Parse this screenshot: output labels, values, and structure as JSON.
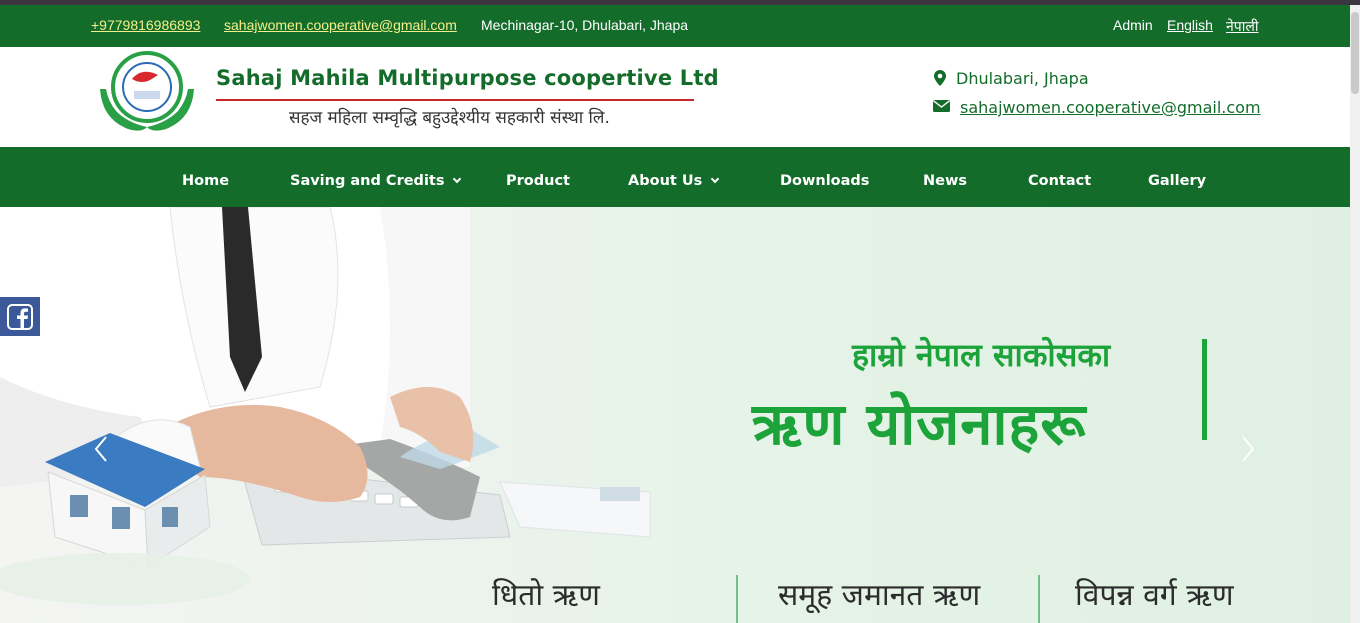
{
  "topbar": {
    "phone": "+9779816986893",
    "email": "sahajwomen.cooperative@gmail.com",
    "address": "Mechinagar-10, Dhulabari, Jhapa",
    "admin": "Admin",
    "lang_en": "English",
    "lang_np": "नेपाली"
  },
  "header": {
    "org_name": "Sahaj Mahila Multipurpose coopertive Ltd",
    "org_subtitle": "सहज महिला सम्वृद्धि बहुउद्देश्यीय सहकारी संस्था लि.",
    "location": "Dhulabari, Jhapa",
    "email": "sahajwomen.cooperative@gmail.com",
    "location_icon": "map-marker-icon",
    "email_icon": "envelope-icon"
  },
  "nav": {
    "items": [
      {
        "label": "Home",
        "has_dropdown": false
      },
      {
        "label": "Saving and Credits",
        "has_dropdown": true
      },
      {
        "label": "Product",
        "has_dropdown": false
      },
      {
        "label": "About Us",
        "has_dropdown": true
      },
      {
        "label": "Downloads",
        "has_dropdown": false
      },
      {
        "label": "News",
        "has_dropdown": false
      },
      {
        "label": "Contact",
        "has_dropdown": false
      },
      {
        "label": "Gallery",
        "has_dropdown": false
      }
    ]
  },
  "hero": {
    "line1": "हाम्रो नेपाल साकोसका",
    "line2": "ऋण योजनाहरू",
    "loans": [
      "धितो ऋण",
      "समूह जमानत ऋण",
      "विपन्न वर्ग ऋण"
    ]
  },
  "colors": {
    "primary_green": "#146c2b",
    "hero_green": "#1ca33a",
    "link_yellow": "#f3f08a",
    "facebook_blue": "#3b5998",
    "rule_red": "#c7272a"
  }
}
